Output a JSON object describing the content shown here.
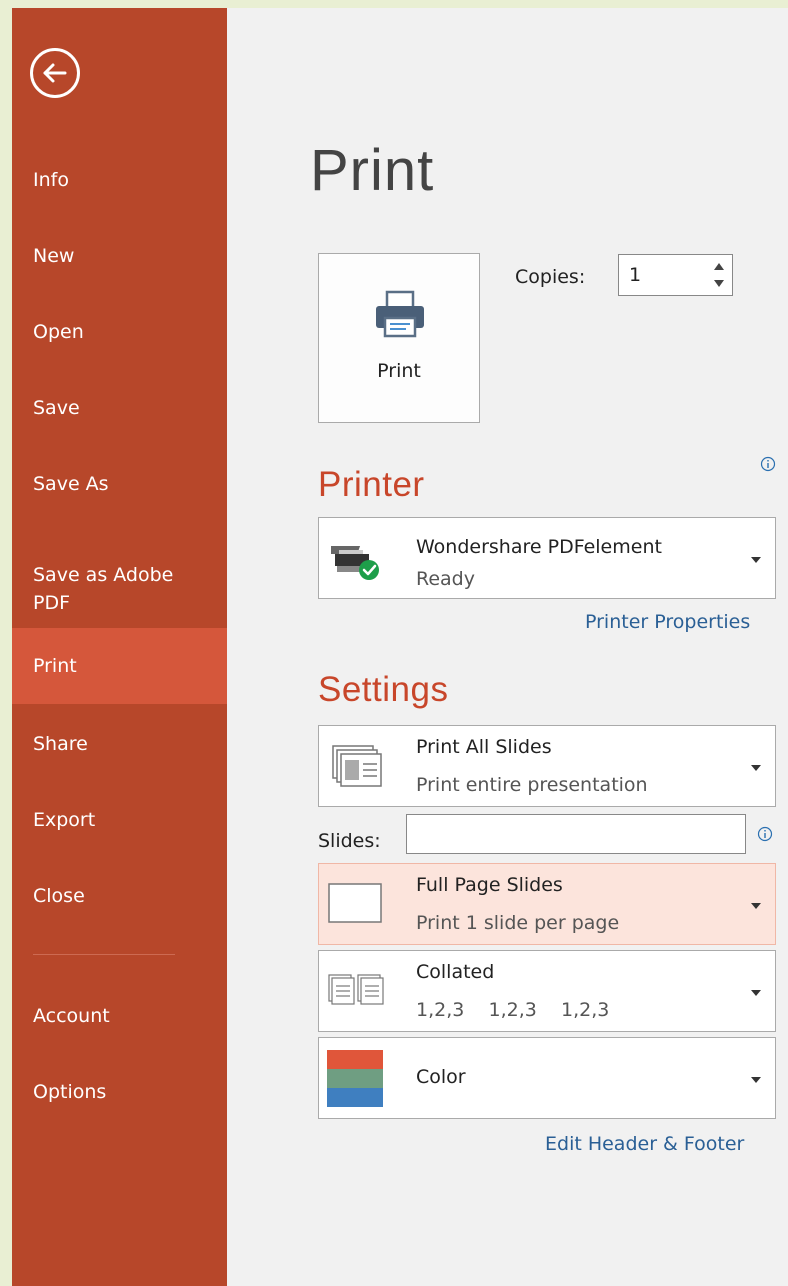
{
  "sidebar": {
    "items": [
      {
        "label": "Info"
      },
      {
        "label": "New"
      },
      {
        "label": "Open"
      },
      {
        "label": "Save"
      },
      {
        "label": "Save As"
      },
      {
        "label": "Save as Adobe PDF"
      },
      {
        "label": "Print",
        "active": true
      },
      {
        "label": "Share"
      },
      {
        "label": "Export"
      },
      {
        "label": "Close"
      }
    ],
    "bottom_items": [
      {
        "label": "Account"
      },
      {
        "label": "Options"
      }
    ],
    "back_icon": "arrow-left-circle-icon"
  },
  "main": {
    "title": "Print",
    "print_button": {
      "label": "Print",
      "icon": "printer-icon"
    },
    "copies": {
      "label": "Copies:",
      "value": "1"
    },
    "printer": {
      "section_title": "Printer",
      "name": "Wondershare PDFelement",
      "status": "Ready",
      "properties_link": "Printer Properties"
    },
    "settings": {
      "section_title": "Settings",
      "slides_range": {
        "title": "Print All Slides",
        "subtitle": "Print entire presentation"
      },
      "slides_label": "Slides:",
      "slides_value": "",
      "layout": {
        "title": "Full Page Slides",
        "subtitle": "Print 1 slide per page"
      },
      "collation": {
        "title": "Collated",
        "subtitle": "1,2,3    1,2,3    1,2,3"
      },
      "color": {
        "title": "Color"
      },
      "header_footer_link": "Edit Header & Footer"
    }
  },
  "colors": {
    "sidebar_bg": "#b7472a",
    "sidebar_active": "#d5573b",
    "section_title": "#c8462a",
    "link": "#2a5f95",
    "highlight_bg": "#fce4dc"
  }
}
